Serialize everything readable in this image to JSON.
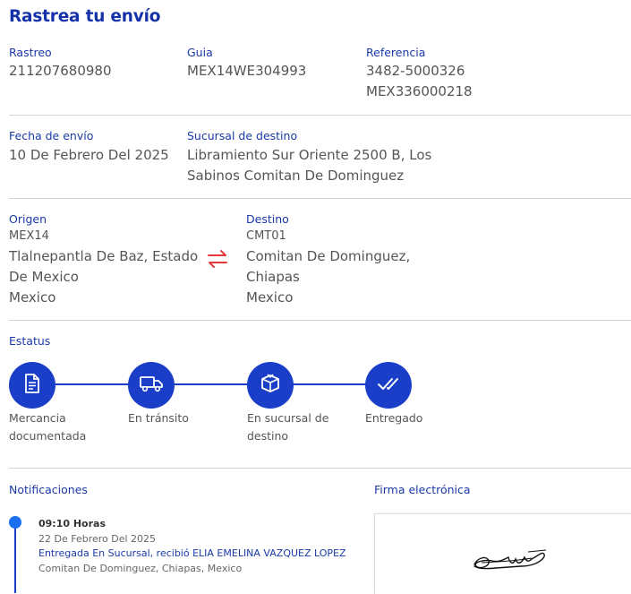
{
  "title": "Rastrea tu envío",
  "tracking": {
    "rastreo_label": "Rastreo",
    "rastreo_value": "211207680980",
    "guia_label": "Guia",
    "guia_value": "MEX14WE304993",
    "referencia_label": "Referencia",
    "referencia_value_1": "3482-5000326",
    "referencia_value_2": "MEX336000218"
  },
  "shipping": {
    "fecha_label": "Fecha de envío",
    "fecha_value": "10 De Febrero Del 2025",
    "sucursal_label": "Sucursal de destino",
    "sucursal_line_1": "Libramiento Sur Oriente 2500 B, Los",
    "sucursal_line_2": "Sabinos Comitan De Dominguez"
  },
  "origin": {
    "label": "Origen",
    "code": "MEX14",
    "city_line_1": "Tlalnepantla De Baz, Estado",
    "city_line_2": "De Mexico",
    "country": "Mexico"
  },
  "destination": {
    "label": "Destino",
    "code": "CMT01",
    "city_line_1": "Comitan De Dominguez,",
    "city_line_2": "Chiapas",
    "country": "Mexico"
  },
  "status": {
    "label": "Estatus",
    "steps": [
      {
        "line_1": "Mercancia",
        "line_2": "documentada",
        "icon": "document-icon"
      },
      {
        "line_1": "En tránsito",
        "line_2": "",
        "icon": "truck-icon"
      },
      {
        "line_1": "En sucursal de",
        "line_2": "destino",
        "icon": "box-icon"
      },
      {
        "line_1": "Entregado",
        "line_2": "",
        "icon": "double-check-icon"
      }
    ]
  },
  "notifications": {
    "label": "Notificaciones",
    "items": [
      {
        "time": "09:10 Horas",
        "date": "22 De Febrero Del 2025",
        "message": "Entregada En Sucursal, recibió ELIA EMELINA VAZQUEZ LOPEZ",
        "location": "Comitan De Dominguez, Chiapas, Mexico"
      }
    ]
  },
  "signature": {
    "label": "Firma electrónica"
  },
  "colors": {
    "primary": "#1a3ec7",
    "label_blue": "#1a3aa8",
    "swap_red": "#e5383b",
    "dot_blue": "#1a6ff0"
  }
}
